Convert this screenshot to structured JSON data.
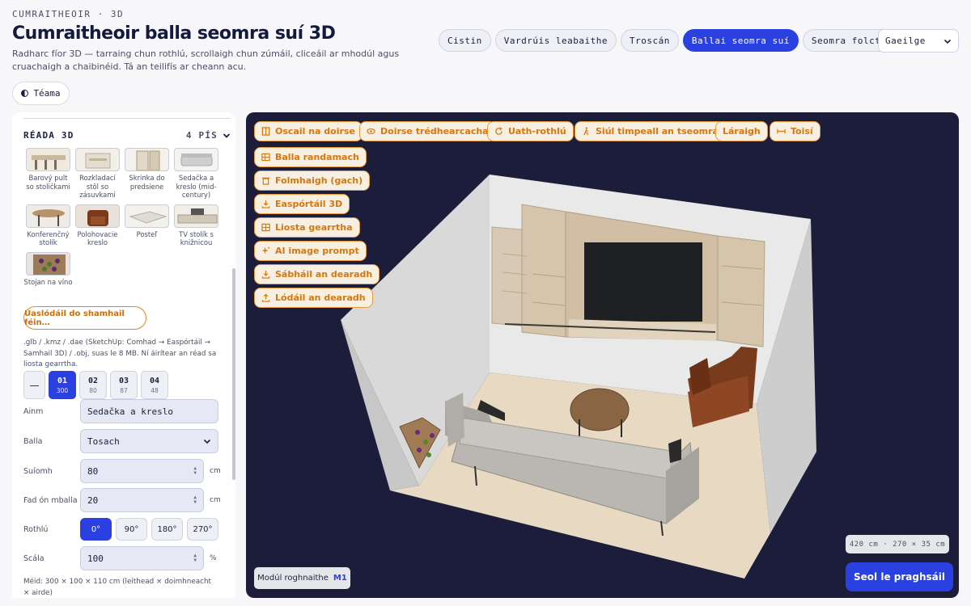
{
  "header": {
    "brand": "CUMRAITHEOIR · 3D",
    "title": "Cumraitheoir balla seomra suí 3D",
    "description": "Radharc fíor 3D — tarraing chun rothlú, scrollaigh chun zúmáil, cliceáil ar mhodúl agus cruachaigh a chaibinéid. Tá an teilifís ar cheann acu.",
    "theme_label": "Téama"
  },
  "rooms": [
    "Cistin",
    "Vardrúis leabaithe",
    "Troscán",
    "Ballai seomra suí",
    "Seomra folctha"
  ],
  "active_room": 3,
  "language": "Gaeilge",
  "catalog": {
    "heading": "RÉADA 3D",
    "count": "4 PÍS",
    "items": [
      {
        "label": "Barový pult so stoličkami",
        "color": "#cfc2ad"
      },
      {
        "label": "Rozkladací stôl so zásuvkami",
        "color": "#e8e2d8"
      },
      {
        "label": "Skrinka do predsiene",
        "color": "#e9e3da"
      },
      {
        "label": "Sedačka a kreslo (mid-century)",
        "color": "#dcdcdc"
      },
      {
        "label": "Konferenčný stolík",
        "color": "#b28f6b"
      },
      {
        "label": "Polohovacie kreslo",
        "color": "#7a3a1c"
      },
      {
        "label": "Posteľ",
        "color": "#e6e4e0"
      },
      {
        "label": "TV stolík s knižnicou",
        "color": "#d8d2c8"
      },
      {
        "label": "Stojan na víno",
        "color": "#8a6a4a"
      }
    ],
    "upload_label": "Uaslódáil do shamhail féin…",
    "upload_note": ".glb / .kmz / .dae (SketchUp: Comhad → Easpórtáil → Samhail 3D) / .obj, suas le 8 MB. Ní áirítear an réad sa liosta gearrtha."
  },
  "modules": {
    "dash": "—",
    "items": [
      {
        "num": "01",
        "val": "300"
      },
      {
        "num": "02",
        "val": "80"
      },
      {
        "num": "03",
        "val": "87"
      },
      {
        "num": "04",
        "val": "48"
      }
    ],
    "active": 0
  },
  "form": {
    "name_label": "Ainm",
    "name_value": "Sedačka a kreslo",
    "wall_label": "Balla",
    "wall_value": "Tosach",
    "pos_label": "Suíomh",
    "pos_value": "80",
    "pos_unit": "cm",
    "dist_label": "Fad ón mballa",
    "dist_value": "20",
    "dist_unit": "cm",
    "rot_label": "Rothlú",
    "rotations": [
      "0°",
      "90°",
      "180°",
      "270°"
    ],
    "rot_active": 0,
    "scale_label": "Scála",
    "scale_value": "100",
    "scale_unit": "%",
    "dims_note": "Méid: 300 × 100 × 110 cm (leithead × doimhneacht × airde)"
  },
  "viewport": {
    "buttons": [
      {
        "label": "Oscail na doirse",
        "icon": "door-icon"
      },
      {
        "label": "Doirse trédhearcacha",
        "icon": "eye-icon"
      },
      {
        "label": "Uath-rothlú",
        "icon": "rotate-icon"
      },
      {
        "label": "Siúl timpeall an tseomra",
        "icon": "walk-icon"
      },
      {
        "label": "Láraigh",
        "icon": ""
      },
      {
        "label": "Toisí",
        "icon": "dimensions-icon"
      },
      {
        "label": "Balla randamach",
        "icon": "grid-icon"
      },
      {
        "label": "Folmhaigh (gach)",
        "icon": "trash-icon"
      },
      {
        "label": "Easpórtáil 3D",
        "icon": "download-icon"
      },
      {
        "label": "Liosta gearrtha",
        "icon": "grid-icon"
      },
      {
        "label": "AI image prompt",
        "icon": "sparkle-icon"
      },
      {
        "label": "Sábháil an dearadh",
        "icon": "download-icon"
      },
      {
        "label": "Lódáil an dearadh",
        "icon": "upload-icon"
      }
    ],
    "room_dims": "420 cm · 270 × 35 cm",
    "selected_label": "Modúl roghnaithe",
    "selected_tag": "M1",
    "price_button": "Seol le praghsáil"
  }
}
